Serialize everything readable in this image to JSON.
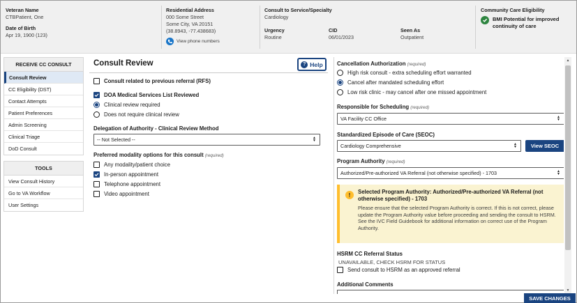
{
  "header": {
    "veteran_name_label": "Veteran Name",
    "veteran_name": "CTBPatient, One",
    "dob_label": "Date of Birth",
    "dob": "Apr 19, 1900 (123)",
    "address_label": "Residential Address",
    "address_line1": "000 Some Street",
    "address_line2": "Some City, VA 20151",
    "address_coords": "(38.8943, -77.438683)",
    "view_phone": "View phone numbers",
    "consult_label": "Consult to Service/Specialty",
    "consult_value": "Cardiology",
    "urgency_label": "Urgency",
    "urgency_value": "Routine",
    "cid_label": "CID",
    "cid_value": "06/01/2023",
    "seen_as_label": "Seen As",
    "seen_as_value": "Outpatient",
    "cc_label": "Community Care Eligibility",
    "cc_value": "BMI Potential for improved continuity of care"
  },
  "nav": {
    "group1_title": "RECEIVE CC CONSULT",
    "group1_items": [
      "Consult Review",
      "CC Eligibility (DST)",
      "Contact Attempts",
      "Patient Preferences",
      "Admin Screening",
      "Clinical Triage",
      "DoD Consult"
    ],
    "group2_title": "TOOLS",
    "group2_items": [
      "View Consult History",
      "Go to VA Workflow",
      "User Settings"
    ]
  },
  "consult_review": {
    "title": "Consult Review",
    "help_label": "Help",
    "rfs_label": "Consult related to previous referral (RFS)",
    "doa_label": "DOA Medical Services List Reviewed",
    "review_options": [
      "Clinical review required",
      "Does not require clinical review"
    ],
    "delegation_label": "Delegation of Authority - Clinical Review Method",
    "delegation_value": "-- Not Selected --",
    "modality_label": "Preferred modality options for this consult",
    "required_tag": "(required)",
    "modality_options": [
      "Any modality/patient choice",
      "In-person appointment",
      "Telephone appointment",
      "Video appointment"
    ]
  },
  "right_panel": {
    "cancel_label": "Cancellation Authorization",
    "cancel_options": [
      "High risk consult - extra scheduling effort warranted",
      "Cancel after mandated scheduling effort",
      "Low risk clinic - may cancel after one missed appointment"
    ],
    "responsible_label": "Responsible for Scheduling",
    "responsible_value": "VA Facility CC Office",
    "seoc_label": "Standardized Episode of Care (SEOC)",
    "seoc_value": "Cardiology Comprehensive",
    "view_seoc": "View SEOC",
    "program_label": "Program Authority",
    "program_value": "Authorized/Pre-authorized VA Referral (not otherwise specified) - 1703",
    "alert_title": "Selected Program Authority: Authorized/Pre-authorized VA Referral (not otherwise specified) - 1703",
    "alert_body": "Please ensure that the selected Program Authority is correct. If this is not correct, please update the Program Authority value before proceeding and sending the consult to HSRM. See the IVC Field Guidebook for additional information on correct use of the Program Authority.",
    "hsrm_label": "HSRM CC Referral Status",
    "hsrm_value": "UNAVAILABLE, CHECK HSRM FOR STATUS",
    "send_hsrm_label": "Send consult to HSRM as an approved referral",
    "comments_label": "Additional Comments"
  },
  "footer": {
    "save_label": "SAVE CHANGES"
  },
  "colors": {
    "primary": "#1a4480",
    "success": "#2e8540",
    "warning": "#ffbe2e",
    "warning_bg": "#faf3d1"
  }
}
